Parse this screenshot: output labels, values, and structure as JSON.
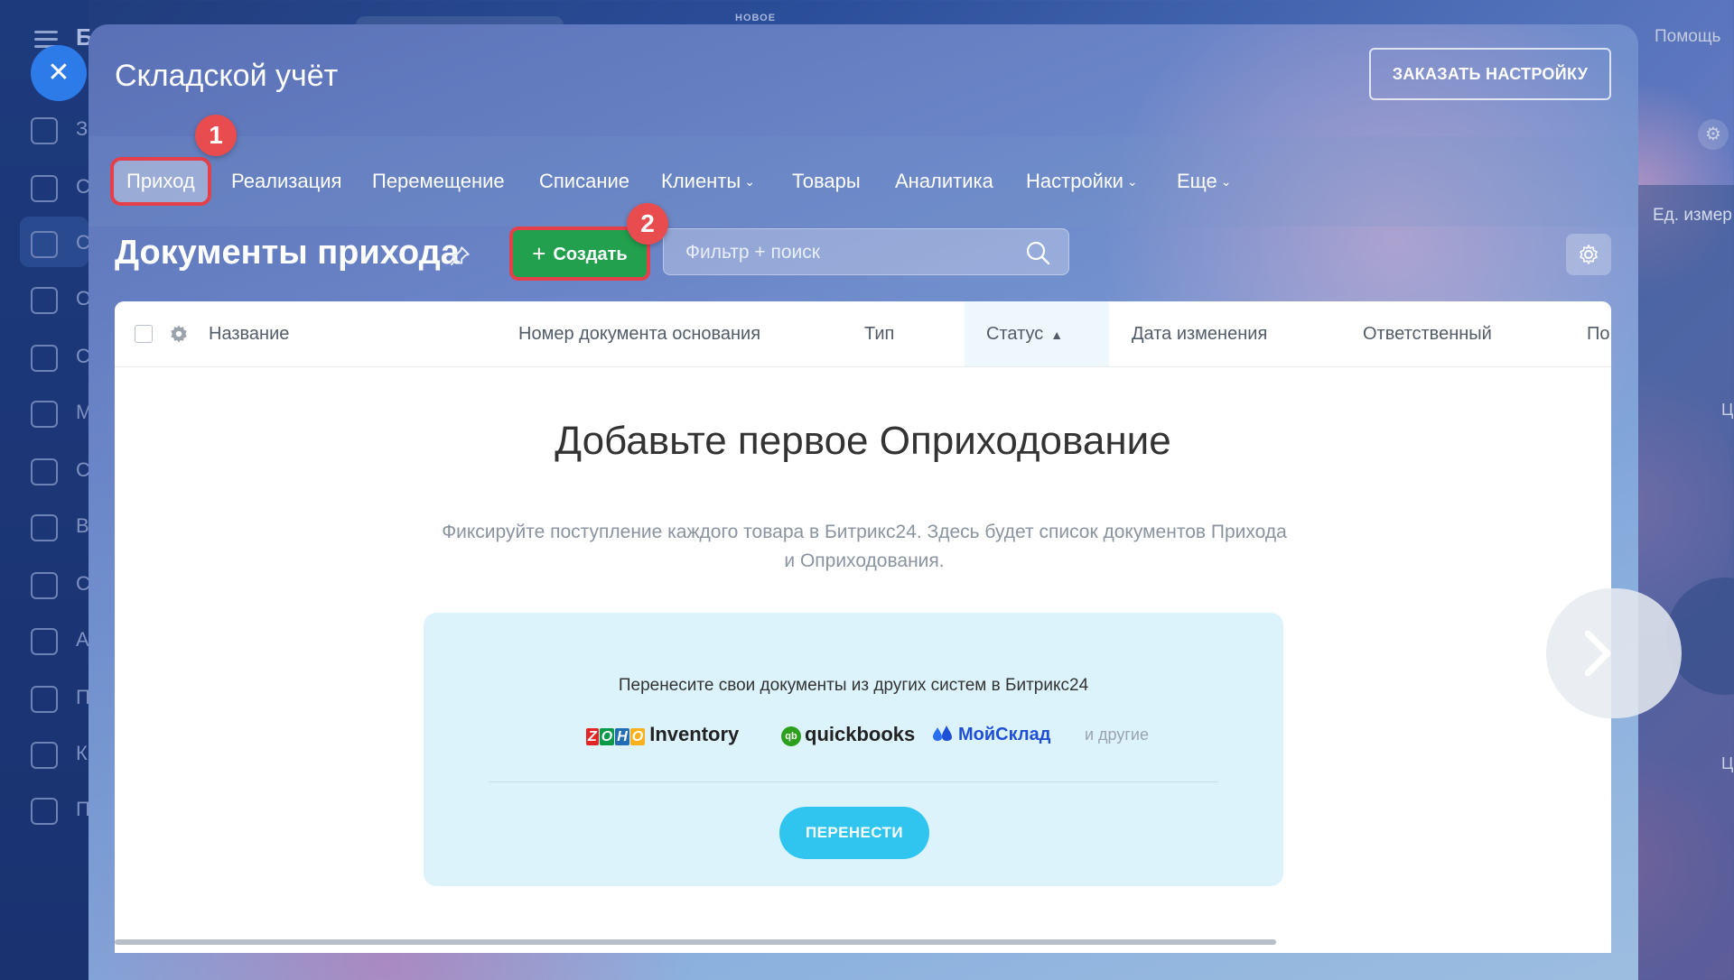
{
  "background": {
    "brand_letter": "Б",
    "top_badge": "НОВОЕ",
    "help_label": "Помощь",
    "right_column_header": "Ед. измер",
    "sidebar_letters": [
      "З",
      "С",
      "С",
      "О",
      "С",
      "М",
      "С",
      "В",
      "С",
      "А",
      "П",
      "К",
      "П"
    ],
    "right_letters": [
      "Ц",
      "Ц"
    ]
  },
  "panel": {
    "title": "Складской учёт",
    "order_button": "ЗАКАЗАТЬ НАСТРОЙКУ",
    "nav": [
      {
        "label": "Приход",
        "active": true,
        "dropdown": false
      },
      {
        "label": "Реализация",
        "dropdown": false
      },
      {
        "label": "Перемещение",
        "dropdown": false
      },
      {
        "label": "Списание",
        "dropdown": false
      },
      {
        "label": "Клиенты",
        "dropdown": true
      },
      {
        "label": "Товары",
        "dropdown": false
      },
      {
        "label": "Аналитика",
        "dropdown": false
      },
      {
        "label": "Настройки",
        "dropdown": true
      },
      {
        "label": "Еще",
        "dropdown": true
      }
    ],
    "step_badges": [
      "1",
      "2"
    ],
    "page_title": "Документы прихода",
    "create_button": "Создать",
    "search_placeholder": "Фильтр + поиск"
  },
  "table": {
    "columns": [
      "Название",
      "Номер документа основания",
      "Тип",
      "Статус",
      "Дата изменения",
      "Ответственный",
      "По"
    ],
    "sorted_column": "Статус"
  },
  "empty_state": {
    "title": "Добавьте первое Оприходование",
    "description": "Фиксируйте поступление каждого товара в Битрикс24. Здесь будет список документов Прихода и Оприходования."
  },
  "migration": {
    "title": "Перенесите свои документы из других систем в Битрикс24",
    "zoho_letters": [
      "Z",
      "O",
      "H",
      "O"
    ],
    "zoho_product": "Inventory",
    "qb_prefix": "qb",
    "qb_name": "quickbooks",
    "ms_name": "МойСклад",
    "others": "и другие",
    "button": "ПЕРЕНЕСТИ"
  },
  "colors": {
    "accent_green": "#22a04e",
    "highlight_red": "#e5404a",
    "migrate_button": "#2fc5ef",
    "migrate_bg": "#dcf3fb"
  }
}
